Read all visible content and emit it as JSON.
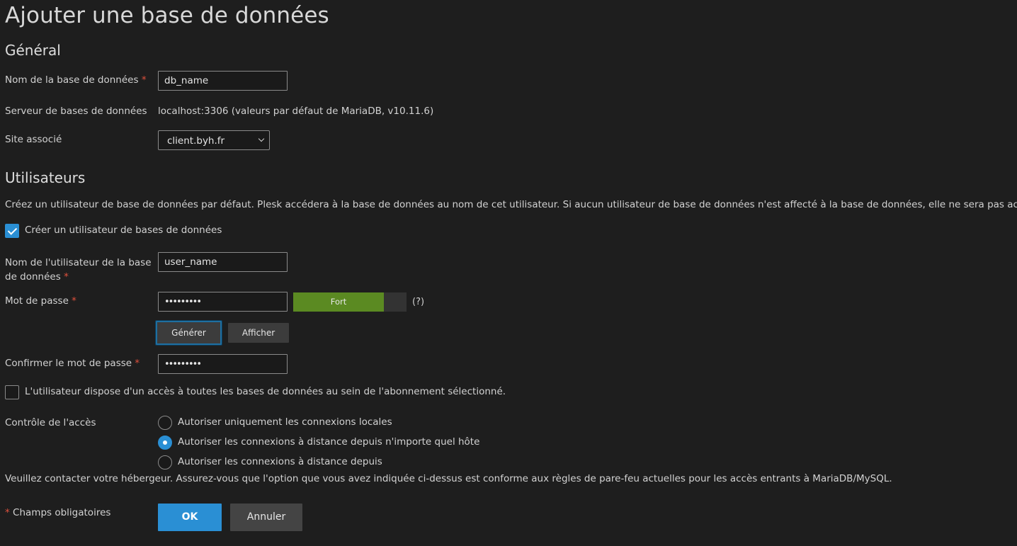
{
  "page": {
    "title": "Ajouter une base de données"
  },
  "general": {
    "heading": "Général",
    "db_name": {
      "label": "Nom de la base de données",
      "value": "db_name"
    },
    "db_server": {
      "label": "Serveur de bases de données",
      "value": "localhost:3306 (valeurs par défaut de MariaDB, v10.11.6)"
    },
    "site": {
      "label": "Site associé",
      "value": "client.byh.fr"
    }
  },
  "users": {
    "heading": "Utilisateurs",
    "description": "Créez un utilisateur de base de données par défaut. Plesk accédera à la base de données au nom de cet utilisateur. Si aucun utilisateur de base de données n'est affecté à la base de données, elle ne sera pas accessible.",
    "create_user": {
      "label": "Créer un utilisateur de bases de données",
      "checked": true
    },
    "username": {
      "label_line1": "Nom de l'utilisateur de la base",
      "label_line2": "de données",
      "value": "user_name"
    },
    "password": {
      "label": "Mot de passe",
      "value": "•••••••••",
      "strength_label": "Fort",
      "strength_fraction": 0.8,
      "help": "(?)",
      "generate_label": "Générer",
      "show_label": "Afficher"
    },
    "confirm_password": {
      "label": "Confirmer le mot de passe",
      "value": "•••••••••"
    },
    "all_databases_access": {
      "label": "L'utilisateur dispose d'un accès à toutes les bases de données au sein de l'abonnement sélectionné.",
      "checked": false
    },
    "access_control": {
      "label": "Contrôle de l'accès",
      "options": [
        {
          "label": "Autoriser uniquement les connexions locales",
          "selected": false
        },
        {
          "label": "Autoriser les connexions à distance depuis n'importe quel hôte",
          "selected": true
        },
        {
          "label": "Autoriser les connexions à distance depuis",
          "selected": false
        }
      ]
    },
    "firewall_note": "Veuillez contacter votre hébergeur. Assurez-vous que l'option que vous avez indiquée ci-dessus est conforme aux règles de pare-feu actuelles pour les accès entrants à MariaDB/MySQL."
  },
  "footer": {
    "required_mark": "*",
    "required_note": "Champs obligatoires",
    "ok_label": "OK",
    "cancel_label": "Annuler"
  },
  "required_marker": "*",
  "colors": {
    "accent": "#2a8fd4",
    "strength_strong": "#5b8a22",
    "required": "#e0513d",
    "background": "#1e1e1e"
  }
}
